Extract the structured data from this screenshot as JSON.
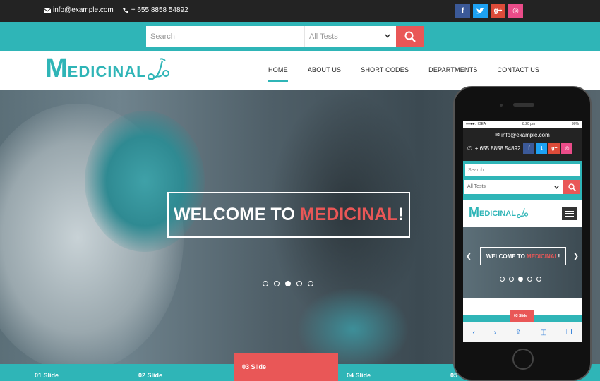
{
  "topbar": {
    "email": "info@example.com",
    "phone": "+ 655 8858 54892",
    "social": [
      {
        "icon": "facebook-icon",
        "label": "f",
        "color": "#3b5998"
      },
      {
        "icon": "twitter-icon",
        "label": "t",
        "color": "#1da1f2"
      },
      {
        "icon": "google-plus-icon",
        "label": "g+",
        "color": "#dd4b39"
      },
      {
        "icon": "dribbble-icon",
        "label": "◎",
        "color": "#ea4c89"
      }
    ]
  },
  "search": {
    "placeholder": "Search",
    "select_value": "All Tests"
  },
  "logo": {
    "first_letter": "M",
    "rest": "EDICINAL"
  },
  "nav": {
    "items": [
      {
        "label": "HOME"
      },
      {
        "label": "ABOUT US"
      },
      {
        "label": "SHORT CODES"
      },
      {
        "label": "DEPARTMENTS"
      },
      {
        "label": "CONTACT US"
      }
    ],
    "active": "HOME"
  },
  "hero": {
    "welcome_prefix": "WELCOME TO ",
    "welcome_highlight": "MEDICINAL",
    "welcome_suffix": "!",
    "active_dot": 3
  },
  "slides": [
    "01 Slide",
    "02 Slide",
    "03 Slide",
    "04 Slide",
    "05 Slide"
  ],
  "mobile": {
    "status_carrier": "●●●●○ IDEA",
    "status_time": "8:20 pm",
    "status_battery": "90%",
    "active_slide": "03 Slide"
  },
  "colors": {
    "accent": "#2fb5b7",
    "highlight": "#e95757",
    "dark": "#232323"
  }
}
